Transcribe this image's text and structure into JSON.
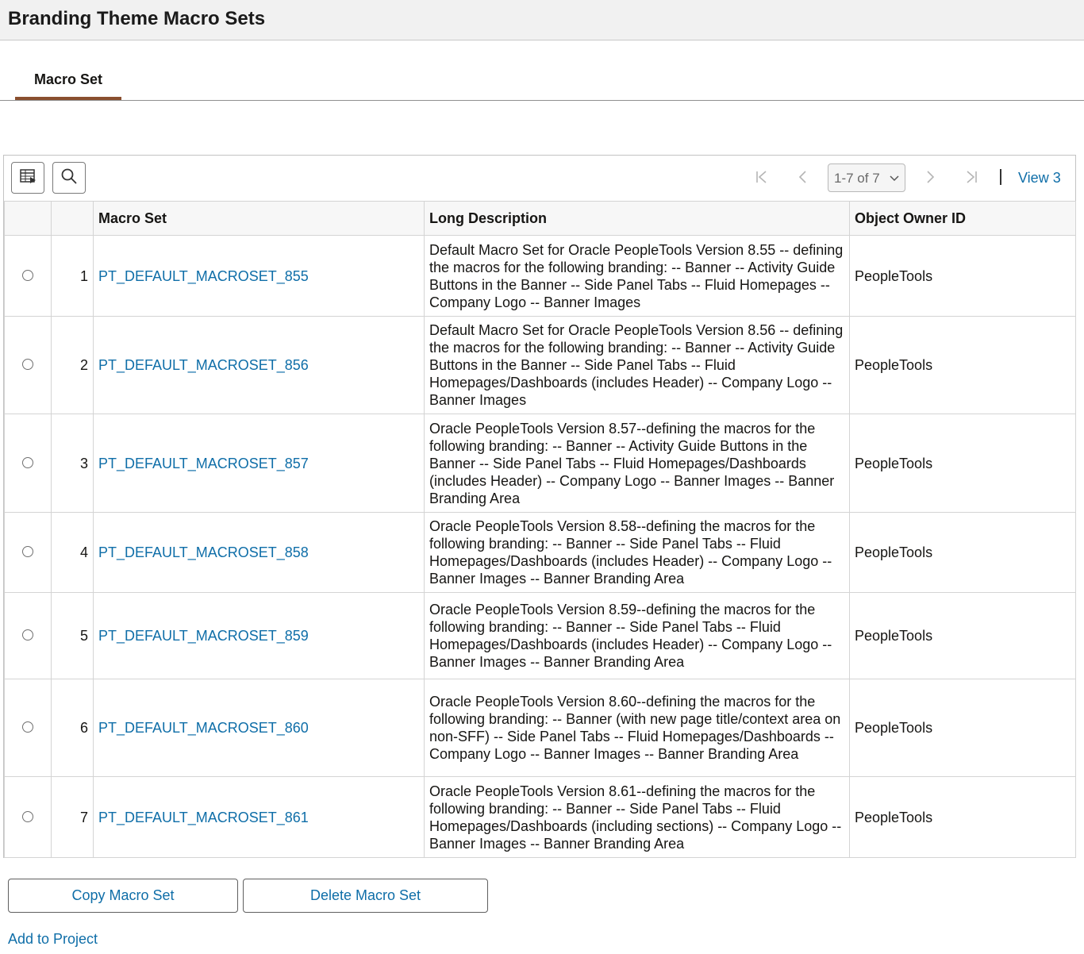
{
  "page": {
    "title": "Branding Theme Macro Sets"
  },
  "tabs": [
    {
      "label": "Macro Set"
    }
  ],
  "toolbar": {
    "icons": [
      "personalize-grid-icon",
      "search-icon"
    ],
    "pager": {
      "range": "1-7 of 7",
      "icons": [
        "first-page-icon",
        "previous-page-icon",
        "next-page-icon",
        "last-page-icon",
        "chevron-down-icon"
      ],
      "view_label": "View 3"
    }
  },
  "grid": {
    "columns": [
      "",
      "",
      "Macro Set",
      "Long Description",
      "Object Owner ID"
    ],
    "rows": [
      {
        "num": "1",
        "macro_set": "PT_DEFAULT_MACROSET_855",
        "description": "Default Macro Set for Oracle PeopleTools Version 8.55 -- defining the macros for the following branding: -- Banner -- Activity Guide Buttons in the Banner -- Side Panel Tabs -- Fluid Homepages -- Company Logo -- Banner Images",
        "owner": "PeopleTools"
      },
      {
        "num": "2",
        "macro_set": "PT_DEFAULT_MACROSET_856",
        "description": "Default Macro Set for Oracle PeopleTools Version 8.56 -- defining the macros for the following branding: -- Banner -- Activity Guide Buttons in the Banner -- Side Panel Tabs -- Fluid Homepages/Dashboards (includes Header) -- Company Logo -- Banner Images",
        "owner": "PeopleTools"
      },
      {
        "num": "3",
        "macro_set": "PT_DEFAULT_MACROSET_857",
        "description": "Oracle PeopleTools Version 8.57--defining the macros for the following branding: -- Banner -- Activity Guide Buttons in the Banner -- Side Panel Tabs -- Fluid Homepages/Dashboards (includes Header) -- Company Logo -- Banner Images -- Banner Branding Area",
        "owner": "PeopleTools"
      },
      {
        "num": "4",
        "macro_set": "PT_DEFAULT_MACROSET_858",
        "description": "Oracle PeopleTools Version 8.58--defining the macros for the following branding: -- Banner -- Side Panel Tabs -- Fluid Homepages/Dashboards (includes Header) -- Company Logo -- Banner Images -- Banner Branding Area",
        "owner": "PeopleTools"
      },
      {
        "num": "5",
        "macro_set": "PT_DEFAULT_MACROSET_859",
        "description": "Oracle PeopleTools Version 8.59--defining the macros for the following branding: -- Banner -- Side Panel Tabs -- Fluid Homepages/Dashboards (includes Header) -- Company Logo -- Banner Images -- Banner Branding Area",
        "owner": "PeopleTools"
      },
      {
        "num": "6",
        "macro_set": "PT_DEFAULT_MACROSET_860",
        "description": "Oracle PeopleTools Version 8.60--defining the macros for the following branding: -- Banner (with new page title/context area on non-SFF) -- Side Panel Tabs -- Fluid Homepages/Dashboards -- Company Logo -- Banner Images -- Banner Branding Area",
        "owner": "PeopleTools"
      },
      {
        "num": "7",
        "macro_set": "PT_DEFAULT_MACROSET_861",
        "description": "Oracle PeopleTools Version 8.61--defining the macros for the following branding: -- Banner -- Side Panel Tabs -- Fluid Homepages/Dashboards (including sections) -- Company Logo -- Banner Images -- Banner Branding Area",
        "owner": "PeopleTools"
      }
    ]
  },
  "actions": {
    "copy_label": "Copy Macro Set",
    "delete_label": "Delete Macro Set",
    "add_to_project_label": "Add to Project"
  },
  "colors": {
    "link": "#0f6ea8",
    "tab_underline": "#8a4f2f"
  }
}
